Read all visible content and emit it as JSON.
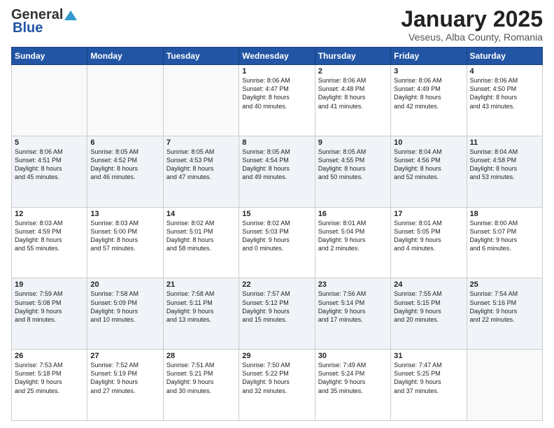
{
  "logo": {
    "general": "General",
    "blue": "Blue"
  },
  "header": {
    "title": "January 2025",
    "subtitle": "Veseus, Alba County, Romania"
  },
  "days_of_week": [
    "Sunday",
    "Monday",
    "Tuesday",
    "Wednesday",
    "Thursday",
    "Friday",
    "Saturday"
  ],
  "weeks": [
    [
      {
        "day": "",
        "info": ""
      },
      {
        "day": "",
        "info": ""
      },
      {
        "day": "",
        "info": ""
      },
      {
        "day": "1",
        "info": "Sunrise: 8:06 AM\nSunset: 4:47 PM\nDaylight: 8 hours\nand 40 minutes."
      },
      {
        "day": "2",
        "info": "Sunrise: 8:06 AM\nSunset: 4:48 PM\nDaylight: 8 hours\nand 41 minutes."
      },
      {
        "day": "3",
        "info": "Sunrise: 8:06 AM\nSunset: 4:49 PM\nDaylight: 8 hours\nand 42 minutes."
      },
      {
        "day": "4",
        "info": "Sunrise: 8:06 AM\nSunset: 4:50 PM\nDaylight: 8 hours\nand 43 minutes."
      }
    ],
    [
      {
        "day": "5",
        "info": "Sunrise: 8:06 AM\nSunset: 4:51 PM\nDaylight: 8 hours\nand 45 minutes."
      },
      {
        "day": "6",
        "info": "Sunrise: 8:05 AM\nSunset: 4:52 PM\nDaylight: 8 hours\nand 46 minutes."
      },
      {
        "day": "7",
        "info": "Sunrise: 8:05 AM\nSunset: 4:53 PM\nDaylight: 8 hours\nand 47 minutes."
      },
      {
        "day": "8",
        "info": "Sunrise: 8:05 AM\nSunset: 4:54 PM\nDaylight: 8 hours\nand 49 minutes."
      },
      {
        "day": "9",
        "info": "Sunrise: 8:05 AM\nSunset: 4:55 PM\nDaylight: 8 hours\nand 50 minutes."
      },
      {
        "day": "10",
        "info": "Sunrise: 8:04 AM\nSunset: 4:56 PM\nDaylight: 8 hours\nand 52 minutes."
      },
      {
        "day": "11",
        "info": "Sunrise: 8:04 AM\nSunset: 4:58 PM\nDaylight: 8 hours\nand 53 minutes."
      }
    ],
    [
      {
        "day": "12",
        "info": "Sunrise: 8:03 AM\nSunset: 4:59 PM\nDaylight: 8 hours\nand 55 minutes."
      },
      {
        "day": "13",
        "info": "Sunrise: 8:03 AM\nSunset: 5:00 PM\nDaylight: 8 hours\nand 57 minutes."
      },
      {
        "day": "14",
        "info": "Sunrise: 8:02 AM\nSunset: 5:01 PM\nDaylight: 8 hours\nand 58 minutes."
      },
      {
        "day": "15",
        "info": "Sunrise: 8:02 AM\nSunset: 5:03 PM\nDaylight: 9 hours\nand 0 minutes."
      },
      {
        "day": "16",
        "info": "Sunrise: 8:01 AM\nSunset: 5:04 PM\nDaylight: 9 hours\nand 2 minutes."
      },
      {
        "day": "17",
        "info": "Sunrise: 8:01 AM\nSunset: 5:05 PM\nDaylight: 9 hours\nand 4 minutes."
      },
      {
        "day": "18",
        "info": "Sunrise: 8:00 AM\nSunset: 5:07 PM\nDaylight: 9 hours\nand 6 minutes."
      }
    ],
    [
      {
        "day": "19",
        "info": "Sunrise: 7:59 AM\nSunset: 5:08 PM\nDaylight: 9 hours\nand 8 minutes."
      },
      {
        "day": "20",
        "info": "Sunrise: 7:58 AM\nSunset: 5:09 PM\nDaylight: 9 hours\nand 10 minutes."
      },
      {
        "day": "21",
        "info": "Sunrise: 7:58 AM\nSunset: 5:11 PM\nDaylight: 9 hours\nand 13 minutes."
      },
      {
        "day": "22",
        "info": "Sunrise: 7:57 AM\nSunset: 5:12 PM\nDaylight: 9 hours\nand 15 minutes."
      },
      {
        "day": "23",
        "info": "Sunrise: 7:56 AM\nSunset: 5:14 PM\nDaylight: 9 hours\nand 17 minutes."
      },
      {
        "day": "24",
        "info": "Sunrise: 7:55 AM\nSunset: 5:15 PM\nDaylight: 9 hours\nand 20 minutes."
      },
      {
        "day": "25",
        "info": "Sunrise: 7:54 AM\nSunset: 5:16 PM\nDaylight: 9 hours\nand 22 minutes."
      }
    ],
    [
      {
        "day": "26",
        "info": "Sunrise: 7:53 AM\nSunset: 5:18 PM\nDaylight: 9 hours\nand 25 minutes."
      },
      {
        "day": "27",
        "info": "Sunrise: 7:52 AM\nSunset: 5:19 PM\nDaylight: 9 hours\nand 27 minutes."
      },
      {
        "day": "28",
        "info": "Sunrise: 7:51 AM\nSunset: 5:21 PM\nDaylight: 9 hours\nand 30 minutes."
      },
      {
        "day": "29",
        "info": "Sunrise: 7:50 AM\nSunset: 5:22 PM\nDaylight: 9 hours\nand 32 minutes."
      },
      {
        "day": "30",
        "info": "Sunrise: 7:49 AM\nSunset: 5:24 PM\nDaylight: 9 hours\nand 35 minutes."
      },
      {
        "day": "31",
        "info": "Sunrise: 7:47 AM\nSunset: 5:25 PM\nDaylight: 9 hours\nand 37 minutes."
      },
      {
        "day": "",
        "info": ""
      }
    ]
  ]
}
